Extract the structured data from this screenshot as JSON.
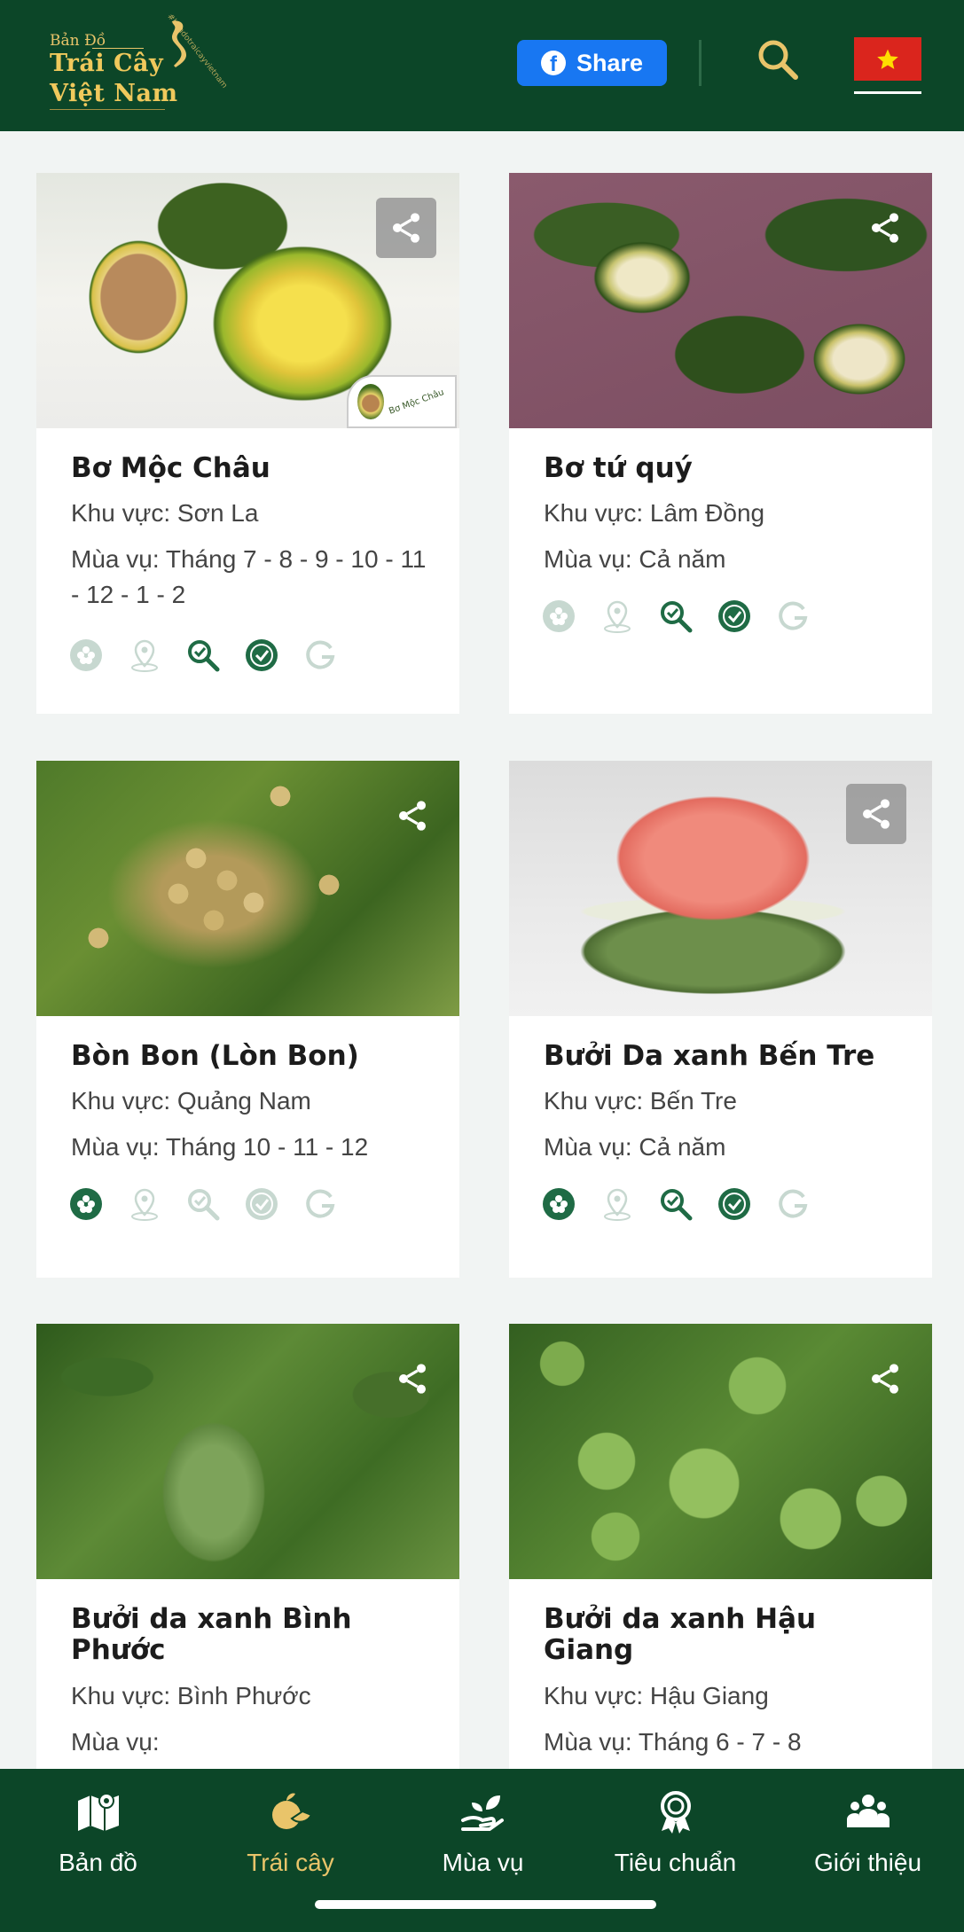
{
  "header": {
    "logo_top": "Bản Đồ",
    "logo_line1": "Trái Cây",
    "logo_line2": "Việt Nam",
    "logo_tagline": "#bandotraicayvietnam",
    "share_label": "Share",
    "share_icon": "facebook-icon",
    "search_icon": "search-icon",
    "language_flag": "vietnam-flag"
  },
  "cards": [
    {
      "title": "Bơ Mộc Châu",
      "region": "Khu vực: Sơn La",
      "season": "Mùa vụ: Tháng 7 - 8 - 9 - 10 - 11 - 12 - 1 - 2",
      "badges": {
        "flower": false,
        "location": false,
        "inspect": true,
        "certified": true,
        "gap": false
      }
    },
    {
      "title": "Bơ tứ quý",
      "region": "Khu vực: Lâm Đồng",
      "season": "Mùa vụ: Cả năm",
      "badges": {
        "flower": false,
        "location": false,
        "inspect": true,
        "certified": true,
        "gap": false
      }
    },
    {
      "title": "Bòn Bon (Lòn Bon)",
      "region": "Khu vực: Quảng Nam",
      "season": "Mùa vụ: Tháng 10 - 11 - 12",
      "badges": {
        "flower": true,
        "location": false,
        "inspect": false,
        "certified": false,
        "gap": false
      }
    },
    {
      "title": "Bưởi Da xanh Bến Tre",
      "region": "Khu vực: Bến Tre",
      "season": "Mùa vụ: Cả năm",
      "badges": {
        "flower": true,
        "location": false,
        "inspect": true,
        "certified": true,
        "gap": false
      }
    },
    {
      "title": "Bưởi da xanh Bình Phước",
      "region": "Khu vực: Bình Phước",
      "season": "Mùa vụ:"
    },
    {
      "title": "Bưởi da xanh Hậu Giang",
      "region": "Khu vực: Hậu Giang",
      "season": "Mùa vụ: Tháng 6 - 7 - 8"
    }
  ],
  "photo_badge_text": "Bơ Mộc Châu",
  "tabs": [
    {
      "label": "Bản đồ",
      "icon": "map-icon",
      "active": false
    },
    {
      "label": "Trái cây",
      "icon": "fruit-icon",
      "active": true
    },
    {
      "label": "Mùa vụ",
      "icon": "harvest-icon",
      "active": false
    },
    {
      "label": "Tiêu chuẩn",
      "icon": "award-icon",
      "active": false
    },
    {
      "label": "Giới thiệu",
      "icon": "people-icon",
      "active": false
    }
  ],
  "colors": {
    "brand_green": "#0c4628",
    "accent_gold": "#e9c46a",
    "badge_active": "#1f6b45",
    "badge_inactive": "#c7d8d0",
    "facebook_blue": "#1877f2"
  }
}
